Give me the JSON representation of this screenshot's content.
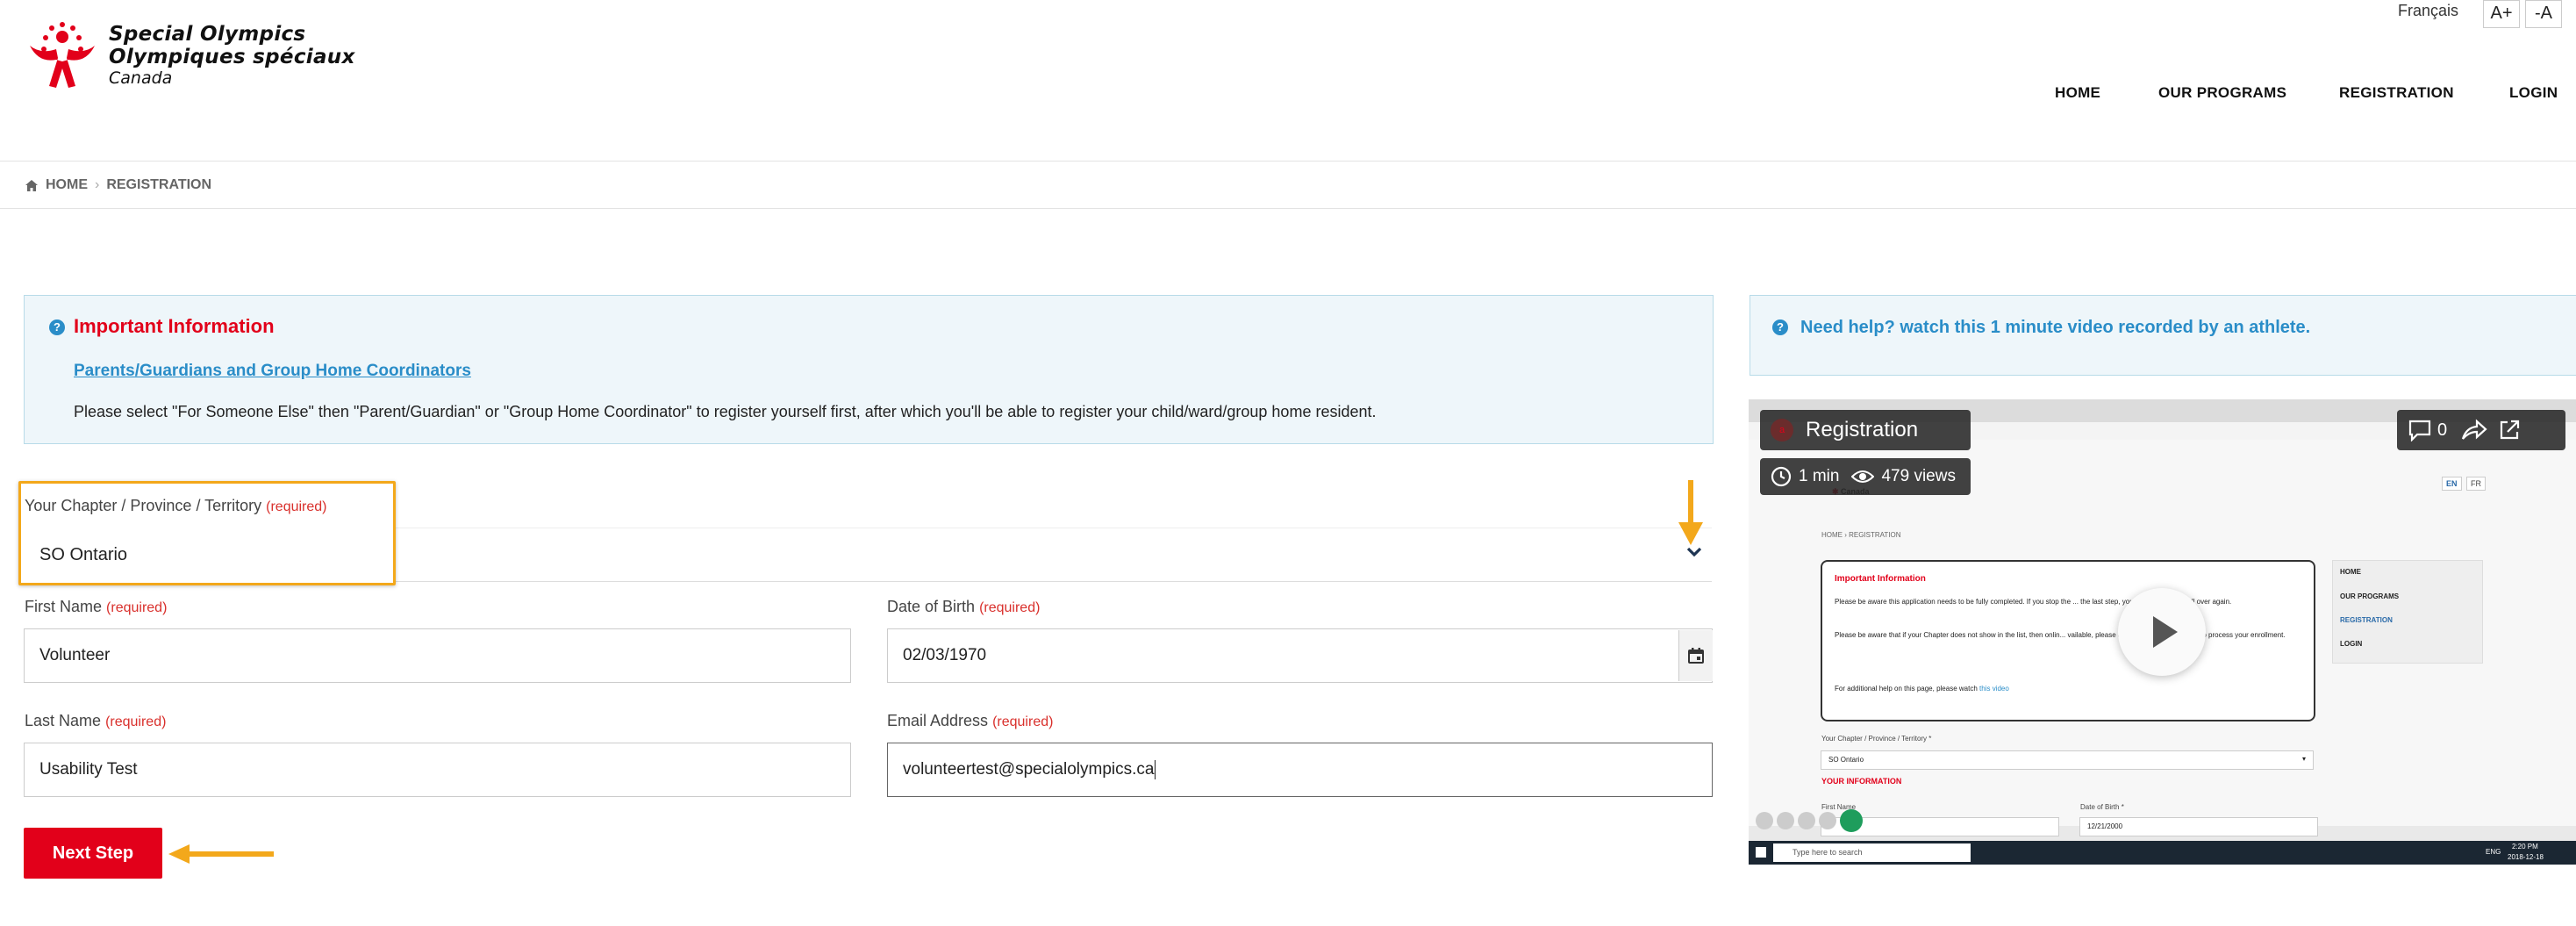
{
  "header": {
    "brand_line1": "Special Olympics",
    "brand_line2": "Olympiques spéciaux",
    "brand_line3": "Canada",
    "lang_link": "Français",
    "font_increase": "A+",
    "font_decrease": "-A",
    "nav": [
      "HOME",
      "OUR PROGRAMS",
      "REGISTRATION",
      "LOGIN"
    ]
  },
  "breadcrumb": {
    "home": "HOME",
    "current": "REGISTRATION"
  },
  "info": {
    "title": "Important Information",
    "link": "Parents/Guardians and Group Home Coordinators",
    "text": "Please select \"For Someone Else\" then \"Parent/Guardian\" or \"Group Home Coordinator\" to register yourself first, after which you'll be able to register your child/ward/group home resident."
  },
  "help": {
    "text": "Need help? watch this 1 minute video recorded by an athlete."
  },
  "form": {
    "required_text": "(required)",
    "chapter_label": "Your Chapter / Province / Territory",
    "chapter_value": "SO Ontario",
    "first_name_label": "First Name",
    "first_name_value": "Volunteer",
    "dob_label": "Date of Birth",
    "dob_value": "02/03/1970",
    "last_name_label": "Last Name",
    "last_name_value": "Usability Test",
    "email_label": "Email Address",
    "email_value": "volunteertest@specialolympics.ca",
    "next_button": "Next Step"
  },
  "video": {
    "title": "Registration",
    "comments": "0",
    "duration": "1 min",
    "views": "479 views",
    "inner": {
      "lang_en": "EN",
      "lang_fr": "FR",
      "breadcrumb": "HOME › REGISTRATION",
      "info_title": "Important Information",
      "info_p1": "Please be aware this application needs to be fully completed. If you stop the ... the last step, you will have to start all over again.",
      "info_p2": "Please be aware that if your Chapter does not show in the list, then onlin... vailable, please approach your community to process your enrollment.",
      "info_p3": "For additional help on this page, please watch",
      "info_link": "this video",
      "menu": [
        "HOME",
        "OUR PROGRAMS",
        "REGISTRATION",
        "LOGIN"
      ],
      "chapter_label": "Your Chapter / Province / Territory *",
      "chapter_value": "SO Ontario",
      "section": "YOUR INFORMATION",
      "first_name": "First Name",
      "dob_label": "Date of Birth *",
      "dob_value": "12/21/2000",
      "taskbar_search": "Type here to search",
      "lang": "ENG",
      "time": "2:20 PM",
      "date": "2018-12-18"
    }
  },
  "colors": {
    "brand_red": "#e2001a",
    "link_blue": "#2a8dc8",
    "highlight_orange": "#f3a81b",
    "info_bg": "#eef6fa"
  }
}
